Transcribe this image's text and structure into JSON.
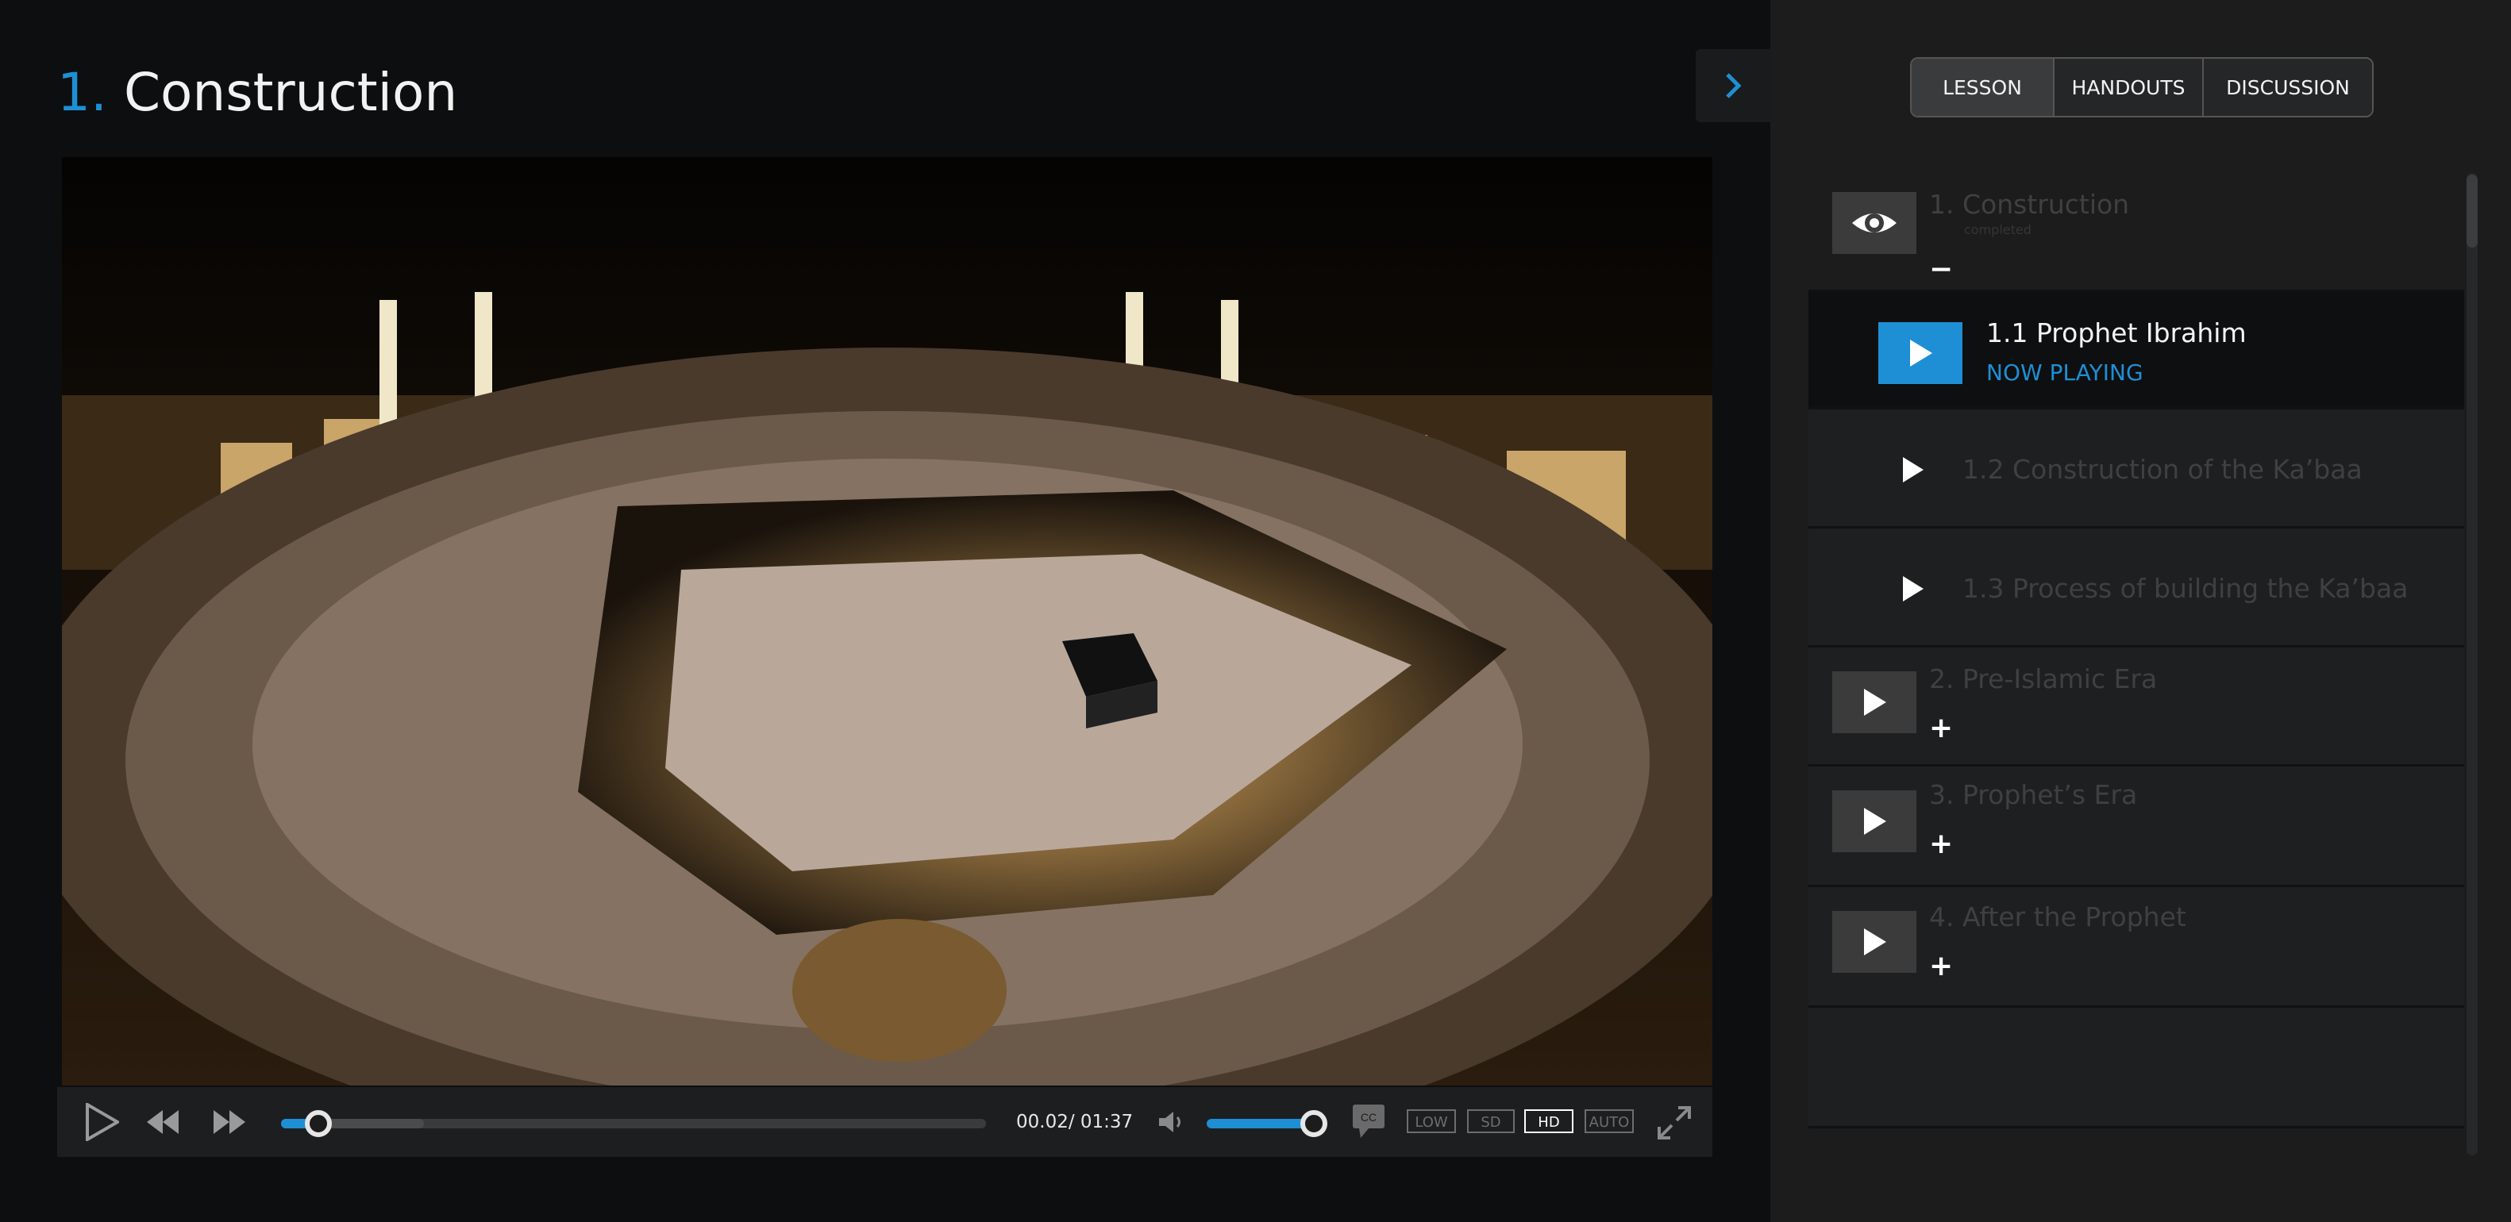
{
  "lesson": {
    "number": "1.",
    "title": "Construction"
  },
  "player": {
    "time": "00.02/ 01:37",
    "progress_fraction": 0.02,
    "volume_fraction": 1.0,
    "cc_label": "CC",
    "quality_options": [
      "LOW",
      "SD",
      "HD",
      "AUTO"
    ],
    "quality_selected": "HD"
  },
  "sidebar": {
    "tabs": [
      {
        "label": "LESSON",
        "active": true
      },
      {
        "label": "HANDOUTS",
        "active": false
      },
      {
        "label": "DISCUSSION",
        "active": false
      }
    ],
    "items": [
      {
        "label": "1. Construction",
        "status": "completed",
        "toggle": "−",
        "icon": "eye-icon"
      },
      {
        "label": "1.1 Prophet Ibrahim",
        "status": "NOW PLAYING",
        "icon": "play-icon"
      },
      {
        "label": "1.2 Construction of the Ka’baa",
        "icon": "play-icon"
      },
      {
        "label": "1.3 Process of building the Ka’baa",
        "icon": "play-icon"
      },
      {
        "label": "2. Pre-Islamic Era",
        "toggle": "+",
        "icon": "play-icon"
      },
      {
        "label": "3. Prophet’s Era",
        "toggle": "+",
        "icon": "play-icon"
      },
      {
        "label": "4. After the Prophet",
        "toggle": "+",
        "icon": "play-icon"
      }
    ]
  },
  "colors": {
    "accent": "#1e8fd5",
    "background": "#0d0e0f",
    "sidebar_bg": "#1c1c1d"
  }
}
